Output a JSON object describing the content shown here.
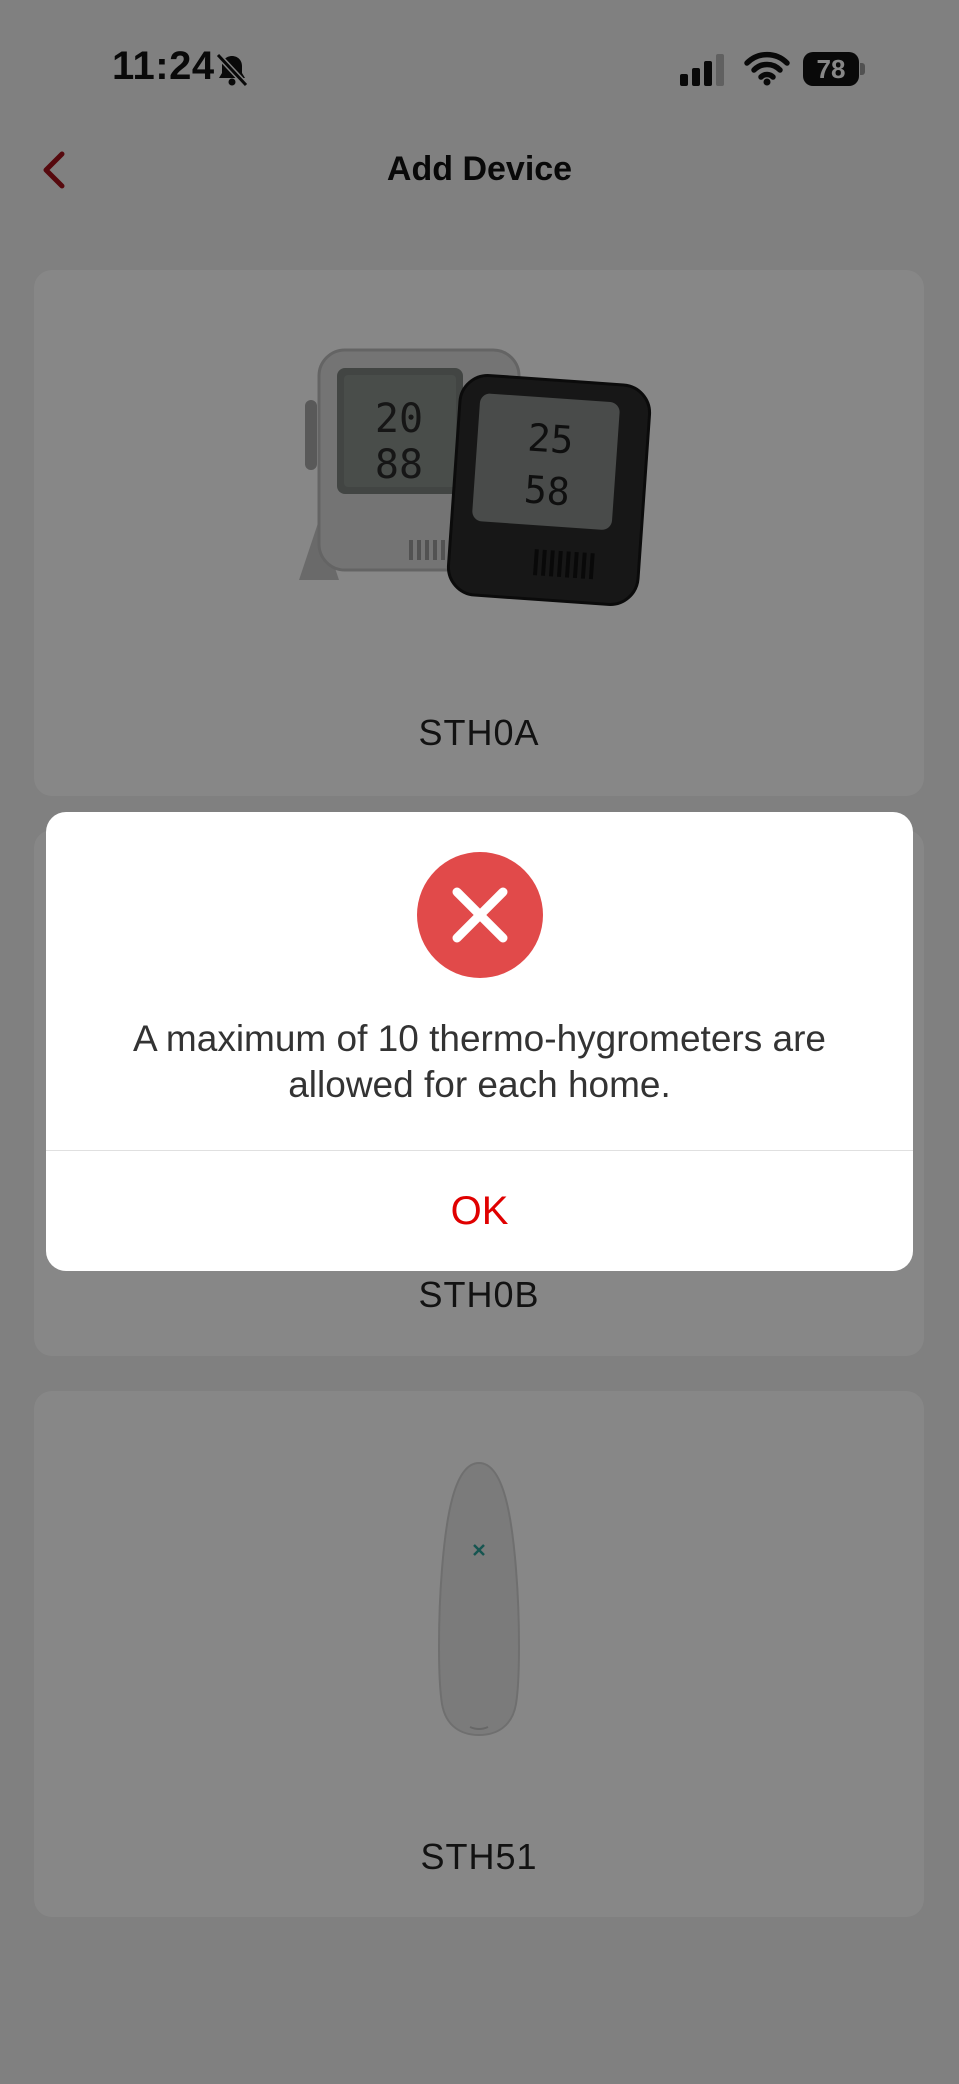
{
  "status_bar": {
    "time": "11:24",
    "battery": "78",
    "silent_icon": "bell-slash-icon",
    "signal_icon": "cellular-signal-icon",
    "wifi_icon": "wifi-icon"
  },
  "nav": {
    "title": "Add Device",
    "back_icon": "chevron-left-icon",
    "accent_color": "#a3111b"
  },
  "devices": [
    {
      "name": "STH0A",
      "image": "thermo-hygrometer-pair-image"
    },
    {
      "name": "STH0B",
      "image": "thermo-hygrometer-image"
    },
    {
      "name": "STH51",
      "image": "sensor-pod-image"
    }
  ],
  "alert": {
    "icon": "error-x-circle-icon",
    "icon_color": "#e14a4a",
    "message": "A maximum of 10 thermo-hygrometers are allowed for each home.",
    "ok_label": "OK",
    "ok_color": "#e00000"
  }
}
